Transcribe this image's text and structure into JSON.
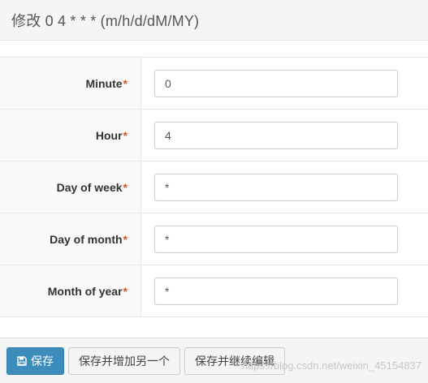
{
  "header": {
    "title": "修改 0 4 * * * (m/h/d/dM/MY)"
  },
  "form": {
    "required_mark": "*",
    "fields": [
      {
        "label": "Minute",
        "value": "0"
      },
      {
        "label": "Hour",
        "value": "4"
      },
      {
        "label": "Day of week",
        "value": "*"
      },
      {
        "label": "Day of month",
        "value": "*"
      },
      {
        "label": "Month of year",
        "value": "*"
      }
    ]
  },
  "footer": {
    "save_label": "保存",
    "save_add_another_label": "保存并增加另一个",
    "save_continue_label": "保存并继续编辑"
  },
  "watermark": "https://blog.csdn.net/weixin_45154837",
  "colors": {
    "primary": "#3c8dbc",
    "required": "#dd4b39",
    "header_bg": "#f5f5f5",
    "label_bg": "#f9f9f9"
  },
  "icons": {
    "save": "floppy-disk-icon"
  }
}
